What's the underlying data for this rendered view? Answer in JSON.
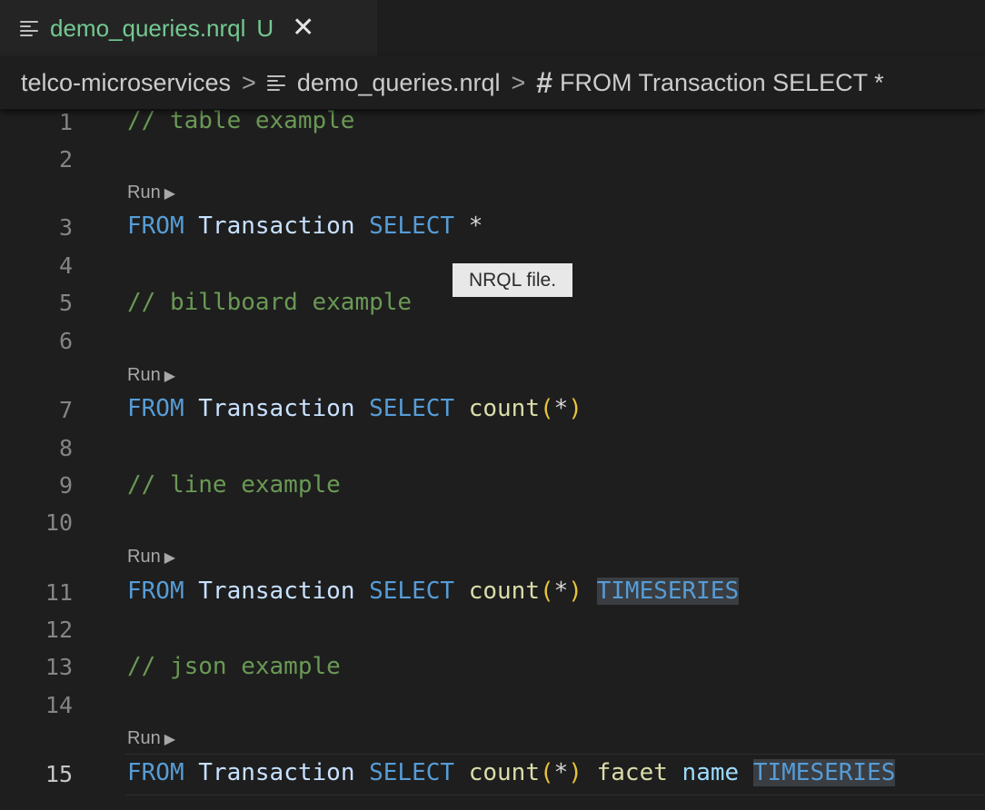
{
  "tab": {
    "title": "demo_queries.nrql",
    "status": "U",
    "close": "✕"
  },
  "breadcrumb": {
    "folder": "telco-microservices",
    "separator": ">",
    "file": "demo_queries.nrql",
    "symbol": "FROM Transaction SELECT *"
  },
  "tooltip": "NRQL file.",
  "codelens": {
    "run_label": "Run",
    "run_arrow": "▶"
  },
  "editor": {
    "line_numbers": [
      "1",
      "2",
      "3",
      "4",
      "5",
      "6",
      "7",
      "8",
      "9",
      "10",
      "11",
      "12",
      "13",
      "14",
      "15"
    ],
    "active_line": 15,
    "lines": {
      "l1": "// table example",
      "l3": {
        "from": "FROM",
        "table": "Transaction",
        "select": "SELECT",
        "star": "*"
      },
      "l5": "// billboard example",
      "l7": {
        "from": "FROM",
        "table": "Transaction",
        "select": "SELECT",
        "fn": "count",
        "open": "(",
        "star": "*",
        "close": ")"
      },
      "l9": "// line example",
      "l11": {
        "from": "FROM",
        "table": "Transaction",
        "select": "SELECT",
        "fn": "count",
        "open": "(",
        "star": "*",
        "close": ")",
        "ts": "TIMESERIES"
      },
      "l13": "// json example",
      "l15": {
        "from": "FROM",
        "table": "Transaction",
        "select": "SELECT",
        "fn": "count",
        "open": "(",
        "star": "*",
        "close": ")",
        "facet": "facet",
        "name": "name",
        "ts": "TIMESERIES"
      }
    }
  },
  "colors": {
    "background": "#1e1e1e",
    "comment": "#6a9955",
    "keyword": "#569cd6",
    "function": "#dcdcaa",
    "untracked": "#73c991"
  }
}
